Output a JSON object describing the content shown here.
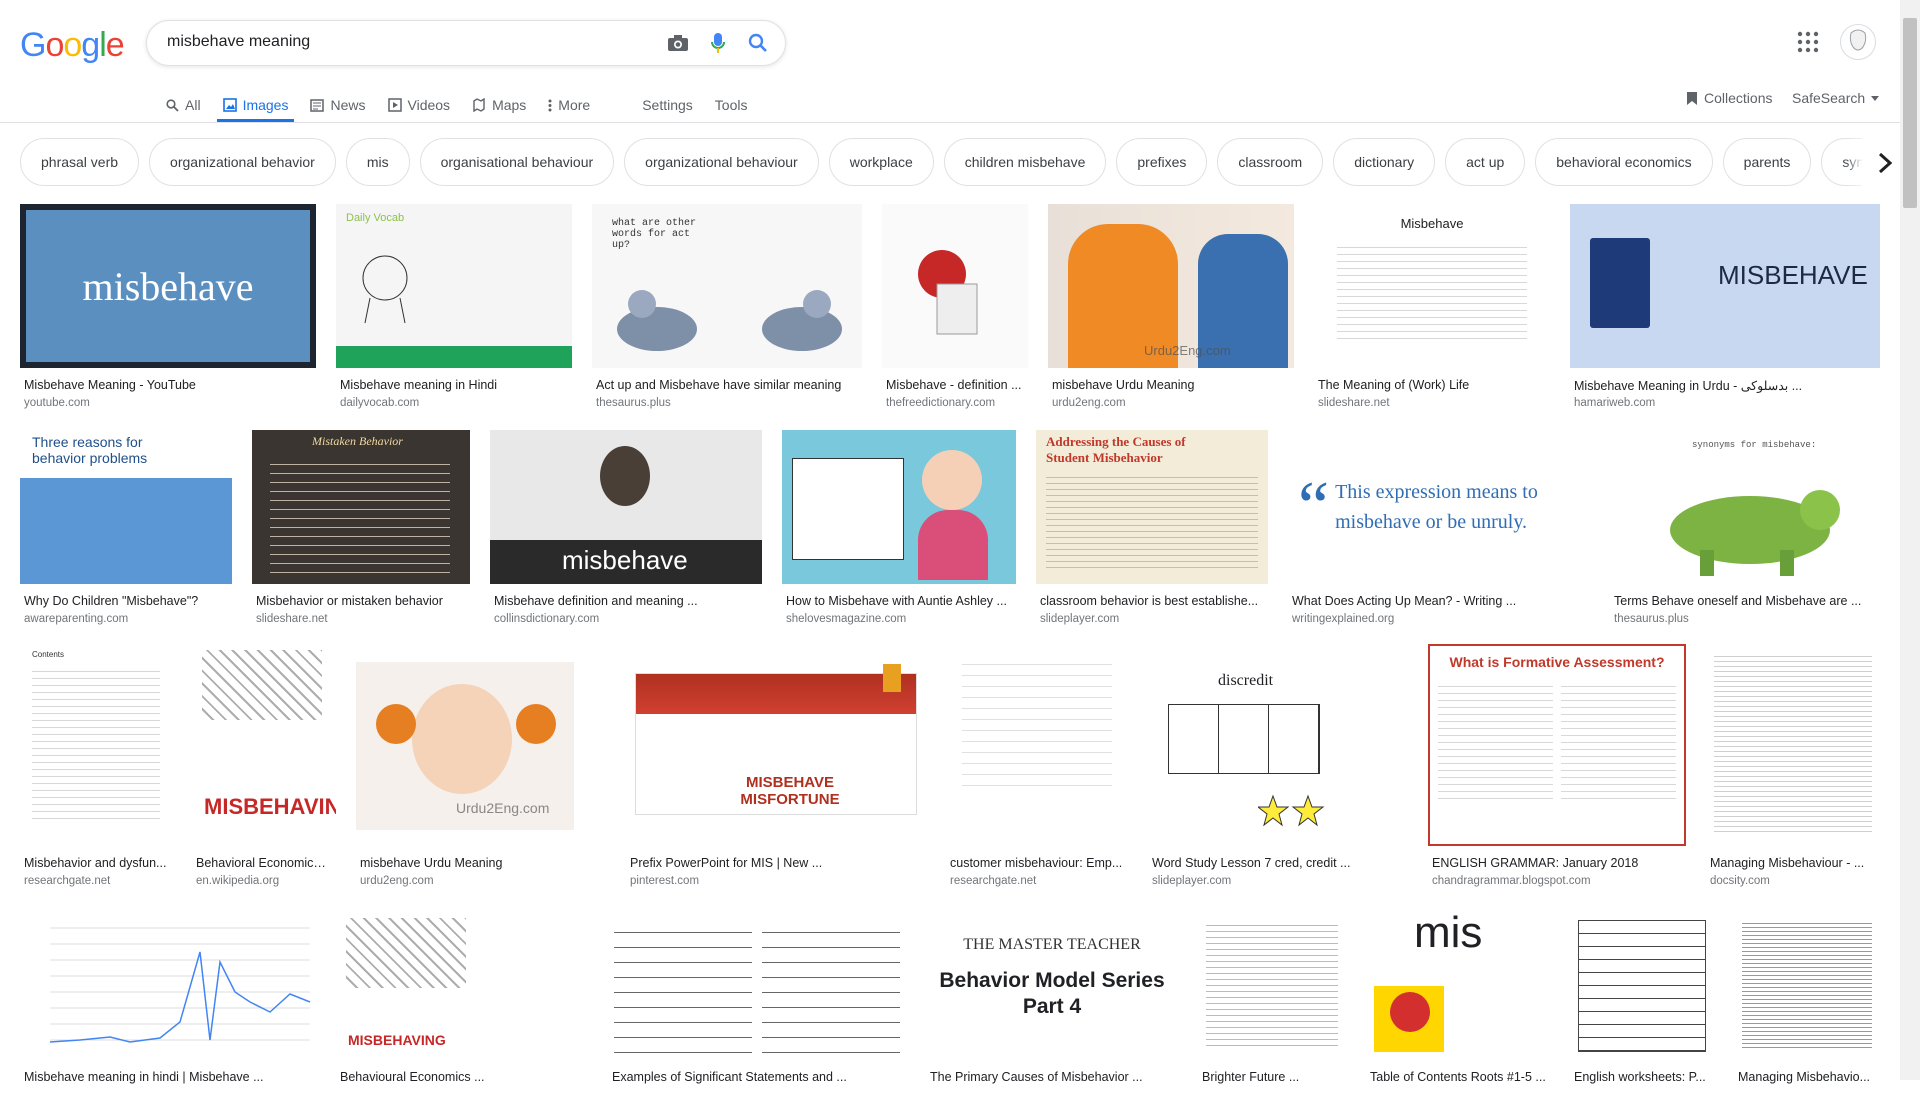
{
  "logo": {
    "letters": [
      "G",
      "o",
      "o",
      "g",
      "l",
      "e"
    ],
    "colors": [
      "#4285f4",
      "#ea4335",
      "#fbbc05",
      "#4285f4",
      "#34a853",
      "#ea4335"
    ]
  },
  "search": {
    "query": "misbehave meaning"
  },
  "tabs": {
    "all": "All",
    "images": "Images",
    "news": "News",
    "videos": "Videos",
    "maps": "Maps",
    "more": "More",
    "settings": "Settings",
    "tools": "Tools"
  },
  "header_right": {
    "collections": "Collections",
    "safesearch": "SafeSearch"
  },
  "chips": [
    "phrasal verb",
    "organizational behavior",
    "mis",
    "organisational behaviour",
    "organizational behaviour",
    "workplace",
    "children misbehave",
    "prefixes",
    "classroom",
    "dictionary",
    "act up",
    "behavioral economics",
    "parents",
    "synonyms"
  ],
  "results": [
    {
      "title": "Misbehave Meaning - YouTube",
      "source": "youtube.com",
      "img_text": "misbehave"
    },
    {
      "title": "Misbehave meaning in Hindi",
      "source": "dailyvocab.com",
      "img_text": "Daily Vocab"
    },
    {
      "title": "Act up and Misbehave have similar meaning",
      "source": "thesaurus.plus",
      "img_text": "what are other words for act up?"
    },
    {
      "title": "Misbehave - definition ...",
      "source": "thefreedictionary.com",
      "img_text": ""
    },
    {
      "title": "misbehave Urdu Meaning",
      "source": "urdu2eng.com",
      "img_text": "Urdu2Eng.com"
    },
    {
      "title": "The Meaning of (Work) Life",
      "source": "slideshare.net",
      "img_text": "Misbehave"
    },
    {
      "title": "Misbehave Meaning in Urdu - بدسلوکی ...",
      "source": "hamariweb.com",
      "img_text": "MISBEHAVE"
    },
    {
      "title": "Why Do Children \"Misbehave\"?",
      "source": "awareparenting.com",
      "img_text": "Three reasons for behavior problems"
    },
    {
      "title": "Misbehavior or mistaken behavior",
      "source": "slideshare.net",
      "img_text": "Mistaken Behavior"
    },
    {
      "title": "Misbehave definition and meaning ...",
      "source": "collinsdictionary.com",
      "img_text": "misbehave"
    },
    {
      "title": "How to Misbehave with Auntie Ashley ...",
      "source": "shelovesmagazine.com",
      "img_text": ""
    },
    {
      "title": "classroom behavior is best establishe...",
      "source": "slideplayer.com",
      "img_text": "Addressing the Causes of Student Misbehavior"
    },
    {
      "title": "What Does Acting Up Mean? - Writing ...",
      "source": "writingexplained.org",
      "img_text": "This expression means to misbehave or be unruly."
    },
    {
      "title": "Terms Behave oneself and Misbehave are ...",
      "source": "thesaurus.plus",
      "img_text": "synonyms for misbehave:"
    },
    {
      "title": "Misbehavior and dysfun...",
      "source": "researchgate.net",
      "img_text": "Contents"
    },
    {
      "title": "Behavioral Economics ...",
      "source": "en.wikipedia.org",
      "img_text": "MISBEHAVING"
    },
    {
      "title": "misbehave Urdu Meaning",
      "source": "urdu2eng.com",
      "img_text": "Urdu2Eng.com"
    },
    {
      "title": "Prefix PowerPoint for MIS | New ...",
      "source": "pinterest.com",
      "img_text": "MISBEHAVE MISFORTUNE"
    },
    {
      "title": "customer misbehaviour: Emp...",
      "source": "researchgate.net",
      "img_text": ""
    },
    {
      "title": "Word Study Lesson 7 cred, credit ...",
      "source": "slideplayer.com",
      "img_text": "discredit"
    },
    {
      "title": "ENGLISH GRAMMAR: January 2018",
      "source": "chandragrammar.blogspot.com",
      "img_text": "What is Formative Assessment?"
    },
    {
      "title": "Managing Misbehaviour - ...",
      "source": "docsity.com",
      "img_text": ""
    },
    {
      "title": "Misbehave meaning in hindi | Misbehave ...",
      "source": "",
      "img_text": ""
    },
    {
      "title": "Behavioural Economics ...",
      "source": "",
      "img_text": "MISBEHAVING"
    },
    {
      "title": "Examples of Significant Statements and ...",
      "source": "",
      "img_text": ""
    },
    {
      "title": "The Primary Causes of Misbehavior ...",
      "source": "",
      "img_text": "Behavior Model Series Part 4"
    },
    {
      "title": "Brighter Future ...",
      "source": "",
      "img_text": ""
    },
    {
      "title": "Table of Contents Roots #1-5 ...",
      "source": "",
      "img_text": "mis"
    },
    {
      "title": "English worksheets: P...",
      "source": "",
      "img_text": ""
    },
    {
      "title": "Managing Misbehavio...",
      "source": "",
      "img_text": ""
    }
  ]
}
